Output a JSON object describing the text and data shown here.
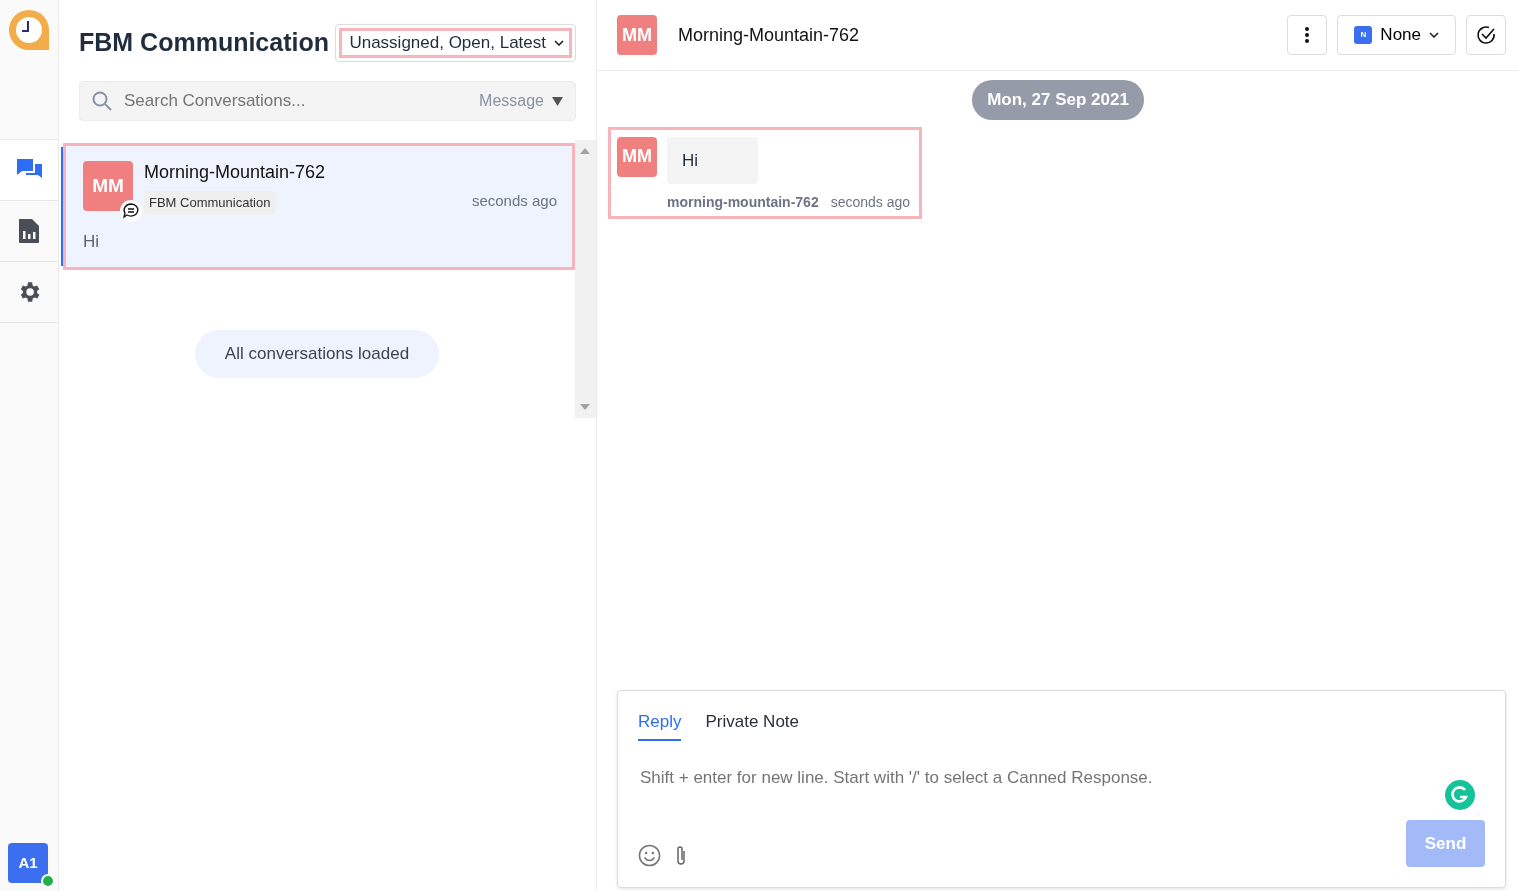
{
  "sidebar": {
    "nav_items": [
      {
        "kind": "conversations",
        "selected": true
      },
      {
        "kind": "reports",
        "selected": false
      },
      {
        "kind": "settings",
        "selected": false
      }
    ],
    "user": {
      "initials": "A1",
      "online": true
    }
  },
  "list": {
    "title": "FBM Communication",
    "filter": "Unassigned, Open, Latest",
    "search": {
      "placeholder": "Search Conversations...",
      "mode": "Message"
    },
    "conversations": [
      {
        "initials": "MM",
        "name": "Morning-Mountain-762",
        "inbox": "FBM Communication",
        "time": "seconds ago",
        "preview": "Hi",
        "selected": true
      }
    ],
    "footer": "All conversations loaded"
  },
  "conversation": {
    "initials": "MM",
    "name": "Morning-Mountain-762",
    "agent": {
      "badge": "N",
      "label": "None"
    },
    "date": "Mon, 27 Sep 2021",
    "messages": [
      {
        "initials": "MM",
        "text": "Hi",
        "sender": "morning-mountain-762",
        "time": "seconds ago"
      }
    ]
  },
  "composer": {
    "tabs": [
      {
        "label": "Reply",
        "selected": true
      },
      {
        "label": "Private Note",
        "selected": false
      }
    ],
    "placeholder": "Shift + enter for new line. Start with '/' to select a Canned Response.",
    "send": {
      "label": "Send",
      "disabled": true
    }
  }
}
